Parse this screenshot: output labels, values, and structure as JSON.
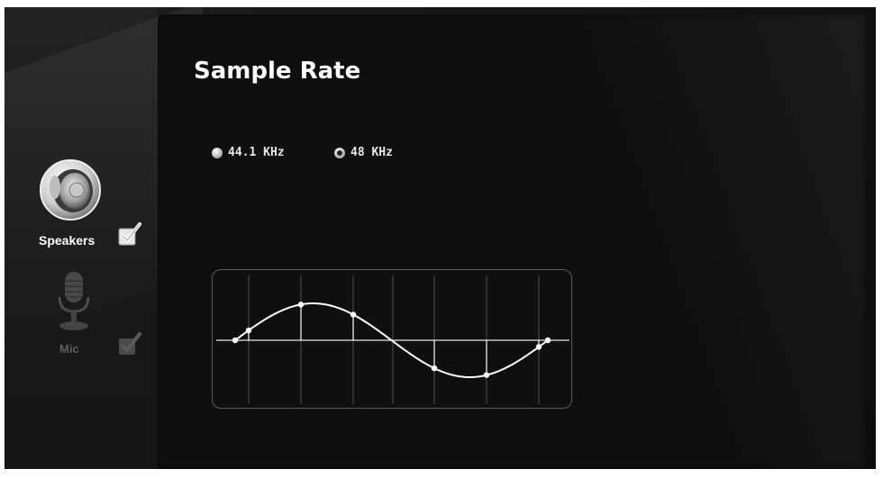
{
  "panel": {
    "title": "Sample Rate"
  },
  "sample_rates": {
    "options": [
      {
        "label": "44.1 KHz",
        "selected": false
      },
      {
        "label": "48 KHz",
        "selected": true
      }
    ]
  },
  "devices": {
    "speakers": {
      "label": "Speakers",
      "enabled": true,
      "icon": "speaker-icon"
    },
    "mic": {
      "label": "Mic",
      "enabled": false,
      "icon": "microphone-icon"
    }
  },
  "waveform": {
    "shape": "sine",
    "cycles": 1,
    "sample_points": 9,
    "color": "#ffffff"
  }
}
